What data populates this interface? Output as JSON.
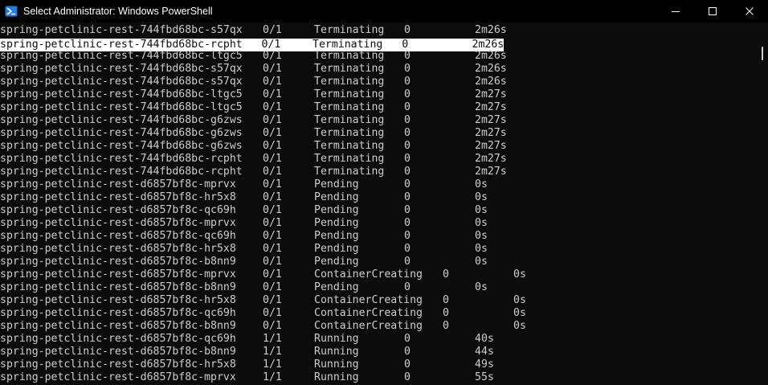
{
  "window": {
    "title": "Select Administrator: Windows PowerShell",
    "app_icon": "powershell-icon",
    "controls": [
      "minimize-icon",
      "maximize-icon",
      "close-icon"
    ]
  },
  "terminal": {
    "rows": [
      {
        "name": "spring-petclinic-rest-744fbd68bc-s57qx",
        "ready": "0/1",
        "status": "Terminating",
        "restarts": "0",
        "age": "2m26s"
      },
      {
        "name": "spring-petclinic-rest-744fbd68bc-rcpht",
        "ready": "0/1",
        "status": "Terminating",
        "restarts": "0",
        "age": "2m26s"
      },
      {
        "name": "spring-petclinic-rest-744fbd68bc-ltgc5",
        "ready": "0/1",
        "status": "Terminating",
        "restarts": "0",
        "age": "2m26s"
      },
      {
        "name": "spring-petclinic-rest-744fbd68bc-s57qx",
        "ready": "0/1",
        "status": "Terminating",
        "restarts": "0",
        "age": "2m26s"
      },
      {
        "name": "spring-petclinic-rest-744fbd68bc-s57qx",
        "ready": "0/1",
        "status": "Terminating",
        "restarts": "0",
        "age": "2m26s"
      },
      {
        "name": "spring-petclinic-rest-744fbd68bc-ltgc5",
        "ready": "0/1",
        "status": "Terminating",
        "restarts": "0",
        "age": "2m27s"
      },
      {
        "name": "spring-petclinic-rest-744fbd68bc-ltgc5",
        "ready": "0/1",
        "status": "Terminating",
        "restarts": "0",
        "age": "2m27s"
      },
      {
        "name": "spring-petclinic-rest-744fbd68bc-g6zws",
        "ready": "0/1",
        "status": "Terminating",
        "restarts": "0",
        "age": "2m27s"
      },
      {
        "name": "spring-petclinic-rest-744fbd68bc-g6zws",
        "ready": "0/1",
        "status": "Terminating",
        "restarts": "0",
        "age": "2m27s"
      },
      {
        "name": "spring-petclinic-rest-744fbd68bc-g6zws",
        "ready": "0/1",
        "status": "Terminating",
        "restarts": "0",
        "age": "2m27s"
      },
      {
        "name": "spring-petclinic-rest-744fbd68bc-rcpht",
        "ready": "0/1",
        "status": "Terminating",
        "restarts": "0",
        "age": "2m27s"
      },
      {
        "name": "spring-petclinic-rest-744fbd68bc-rcpht",
        "ready": "0/1",
        "status": "Terminating",
        "restarts": "0",
        "age": "2m27s"
      },
      {
        "name": "spring-petclinic-rest-d6857bf8c-mprvx",
        "ready": "0/1",
        "status": "Pending",
        "restarts": "0",
        "age": "0s"
      },
      {
        "name": "spring-petclinic-rest-d6857bf8c-hr5x8",
        "ready": "0/1",
        "status": "Pending",
        "restarts": "0",
        "age": "0s"
      },
      {
        "name": "spring-petclinic-rest-d6857bf8c-qc69h",
        "ready": "0/1",
        "status": "Pending",
        "restarts": "0",
        "age": "0s"
      },
      {
        "name": "spring-petclinic-rest-d6857bf8c-mprvx",
        "ready": "0/1",
        "status": "Pending",
        "restarts": "0",
        "age": "0s"
      },
      {
        "name": "spring-petclinic-rest-d6857bf8c-qc69h",
        "ready": "0/1",
        "status": "Pending",
        "restarts": "0",
        "age": "0s"
      },
      {
        "name": "spring-petclinic-rest-d6857bf8c-hr5x8",
        "ready": "0/1",
        "status": "Pending",
        "restarts": "0",
        "age": "0s"
      },
      {
        "name": "spring-petclinic-rest-d6857bf8c-b8nn9",
        "ready": "0/1",
        "status": "Pending",
        "restarts": "0",
        "age": "0s"
      },
      {
        "name": "spring-petclinic-rest-d6857bf8c-mprvx",
        "ready": "0/1",
        "status": "ContainerCreating",
        "restarts": "0",
        "age": "0s"
      },
      {
        "name": "spring-petclinic-rest-d6857bf8c-b8nn9",
        "ready": "0/1",
        "status": "Pending",
        "restarts": "0",
        "age": "0s"
      },
      {
        "name": "spring-petclinic-rest-d6857bf8c-hr5x8",
        "ready": "0/1",
        "status": "ContainerCreating",
        "restarts": "0",
        "age": "0s"
      },
      {
        "name": "spring-petclinic-rest-d6857bf8c-qc69h",
        "ready": "0/1",
        "status": "ContainerCreating",
        "restarts": "0",
        "age": "0s"
      },
      {
        "name": "spring-petclinic-rest-d6857bf8c-b8nn9",
        "ready": "0/1",
        "status": "ContainerCreating",
        "restarts": "0",
        "age": "0s"
      },
      {
        "name": "spring-petclinic-rest-d6857bf8c-qc69h",
        "ready": "1/1",
        "status": "Running",
        "restarts": "0",
        "age": "40s"
      },
      {
        "name": "spring-petclinic-rest-d6857bf8c-b8nn9",
        "ready": "1/1",
        "status": "Running",
        "restarts": "0",
        "age": "44s"
      },
      {
        "name": "spring-petclinic-rest-d6857bf8c-hr5x8",
        "ready": "1/1",
        "status": "Running",
        "restarts": "0",
        "age": "49s"
      },
      {
        "name": "spring-petclinic-rest-d6857bf8c-mprvx",
        "ready": "1/1",
        "status": "Running",
        "restarts": "0",
        "age": "55s"
      }
    ],
    "selected_row": 1
  },
  "colors": {
    "background": "#0c0c0c",
    "text": "#cccccc",
    "titlebar": "#000000",
    "selection": "#ffffff",
    "icon_blue": "#2a7bd6"
  }
}
